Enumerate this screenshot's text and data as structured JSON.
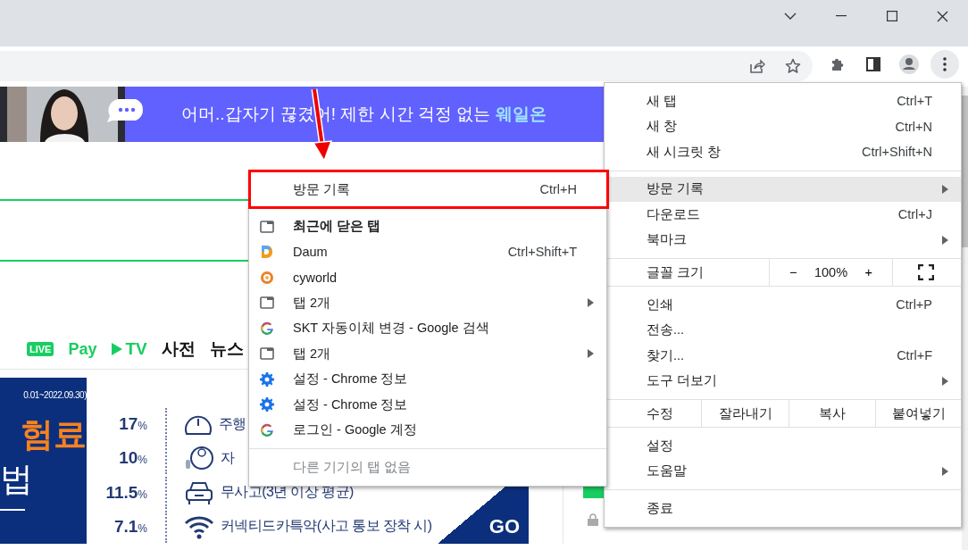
{
  "banner": {
    "text": "어머..갑자기 끊겼어! 제한 시간 걱정 없는 ",
    "highlight": "웨일온"
  },
  "nav": [
    {
      "kind": "badge",
      "label": "LIVE"
    },
    {
      "kind": "green",
      "label": "Pay"
    },
    {
      "kind": "play",
      "label": "TV"
    },
    {
      "kind": "plain",
      "label": "사전"
    },
    {
      "kind": "plain",
      "label": "뉴스"
    }
  ],
  "ad": {
    "period": "0.01~2022.09.30)",
    "headline": "험료",
    "subline": "법",
    "rates": [
      {
        "kind": "gauge",
        "rate": "17",
        "unit": "%",
        "label": "주행"
      },
      {
        "kind": "baby",
        "rate": "10",
        "unit": "%",
        "label": "자"
      },
      {
        "kind": "car",
        "rate": "11.5",
        "unit": "%",
        "label": "무사고(3년 이상 평균)"
      },
      {
        "kind": "wifi",
        "rate": "7.1",
        "unit": "%",
        "label": "커넥티드카특약(사고 통보 장착 시)"
      }
    ],
    "go": "GO"
  },
  "history_menu": {
    "title": "방문 기록",
    "shortcut": "Ctrl+H",
    "items": [
      {
        "kind": "tab",
        "label": "최근에 닫은 탭",
        "bold": true,
        "submenu": false
      },
      {
        "kind": "daum",
        "label": "Daum",
        "shortcut": "Ctrl+Shift+T",
        "bold": false,
        "submenu": false
      },
      {
        "kind": "ring",
        "label": "cyworld",
        "bold": false,
        "submenu": false
      },
      {
        "kind": "tab",
        "label": "탭 2개",
        "bold": false,
        "submenu": true
      },
      {
        "kind": "google",
        "label": "SKT 자동이체 변경 - Google 검색",
        "bold": false,
        "submenu": false
      },
      {
        "kind": "tab",
        "label": "탭 2개",
        "bold": false,
        "submenu": true
      },
      {
        "kind": "gear",
        "label": "설정 - Chrome 정보",
        "bold": false,
        "submenu": false
      },
      {
        "kind": "gear",
        "label": "설정 - Chrome 정보",
        "bold": false,
        "submenu": false
      },
      {
        "kind": "google",
        "label": "로그인 - Google 계정",
        "bold": false,
        "submenu": false
      }
    ],
    "footer": "다른 기기의 탭 없음"
  },
  "main_menu": {
    "sections": [
      {
        "kind": "items",
        "items": [
          {
            "label": "새 탭",
            "shortcut": "Ctrl+T",
            "submenu": false,
            "selected": false
          },
          {
            "label": "새 창",
            "shortcut": "Ctrl+N",
            "submenu": false,
            "selected": false
          },
          {
            "label": "새 시크릿 창",
            "shortcut": "Ctrl+Shift+N",
            "submenu": false,
            "selected": false
          }
        ]
      },
      {
        "kind": "items",
        "items": [
          {
            "label": "방문 기록",
            "submenu": true,
            "selected": true
          },
          {
            "label": "다운로드",
            "shortcut": "Ctrl+J",
            "submenu": false,
            "selected": false
          },
          {
            "label": "북마크",
            "submenu": true,
            "selected": false
          }
        ]
      },
      {
        "kind": "zoom",
        "label": "글꼴 크기",
        "minus": "−",
        "value": "100%",
        "plus": "+"
      },
      {
        "kind": "items",
        "items": [
          {
            "label": "인쇄",
            "shortcut": "Ctrl+P",
            "submenu": false,
            "selected": false
          },
          {
            "label": "전송...",
            "submenu": false,
            "selected": false
          },
          {
            "label": "찾기...",
            "shortcut": "Ctrl+F",
            "submenu": false,
            "selected": false
          },
          {
            "label": "도구 더보기",
            "submenu": true,
            "selected": false
          }
        ]
      },
      {
        "kind": "edit",
        "label": "수정",
        "actions": [
          "잘라내기",
          "복사",
          "붙여넣기"
        ]
      },
      {
        "kind": "items",
        "items": [
          {
            "label": "설정",
            "submenu": false,
            "selected": false
          },
          {
            "label": "도움말",
            "submenu": true,
            "selected": false
          }
        ]
      },
      {
        "kind": "items",
        "items": [
          {
            "label": "종료",
            "submenu": false,
            "selected": false
          }
        ]
      }
    ]
  }
}
